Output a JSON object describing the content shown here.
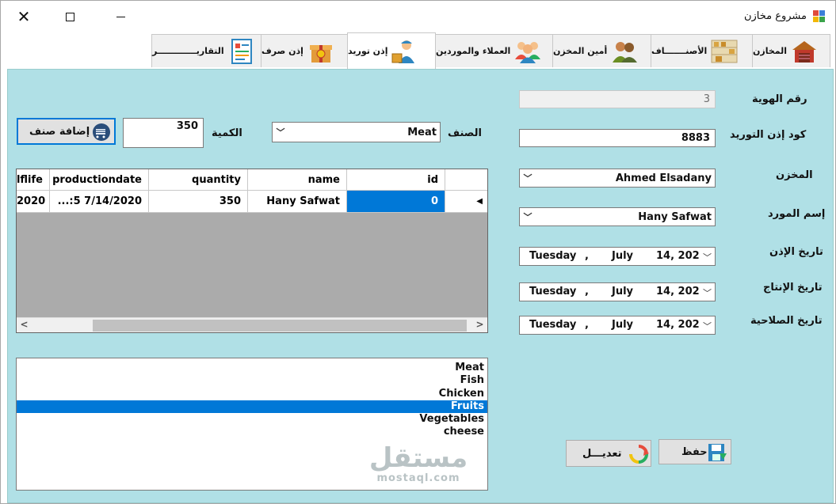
{
  "window": {
    "title": "مشروع مخازن",
    "close_glyph": "✕"
  },
  "tabs": [
    {
      "label": "المخازن",
      "icon": "warehouse-icon"
    },
    {
      "label": "الأصنـــــــاف",
      "icon": "shelves-icon"
    },
    {
      "label": "أمين المخزن",
      "icon": "storekeeper-icon"
    },
    {
      "label": "العملاء والموردين",
      "icon": "people-group-icon"
    },
    {
      "label": "إذن توريد",
      "icon": "delivery-worker-icon",
      "active": true
    },
    {
      "label": "إذن صرف",
      "icon": "gift-box-icon"
    },
    {
      "label": "التقاريـــــــــــــر",
      "icon": "report-icon"
    }
  ],
  "form": {
    "id_label": "رقم الهوية",
    "id_value": "3",
    "supply_code_label": "كود إذن التوريد",
    "supply_code_value": "8883",
    "warehouse_label": "المخزن",
    "warehouse_value": "Ahmed Elsadany",
    "supplier_label": "إسم المورد",
    "supplier_value": "Hany Safwat",
    "permit_date_label": "تاريخ الإذن",
    "production_date_label": "تاريخ الإنتاج",
    "expiry_date_label": "تاريخ الصلاحية",
    "date_display": {
      "weekday": "Tuesday",
      "sep": ",",
      "month": "July",
      "dayyear": "14, 202"
    },
    "item_label": "الصنف",
    "item_value": "Meat",
    "quantity_label": "الكمية",
    "quantity_value": "350",
    "add_item_button": "إضافة صنف",
    "save_button": "حفظ",
    "edit_button": "تعديـــل"
  },
  "grid": {
    "columns": [
      "id",
      "name",
      "quantity",
      "productiondate",
      "lflife"
    ],
    "row": {
      "id": "0",
      "name": "Hany Safwat",
      "quantity": "350",
      "productiondate": "...:5 7/14/2020",
      "lflife": "2020"
    },
    "row_marker": "◀",
    "scroll_left": "<",
    "scroll_right": ">"
  },
  "items_list": [
    "Meat",
    "Fish",
    "Chicken",
    "Fruits",
    "Vegetables",
    "cheese"
  ],
  "selected_item_index": 3,
  "watermark": {
    "line1": "مستقل",
    "line2": "mostaql.com"
  },
  "colors": {
    "panel": "#b0e0e6",
    "selection": "#0078d7"
  }
}
